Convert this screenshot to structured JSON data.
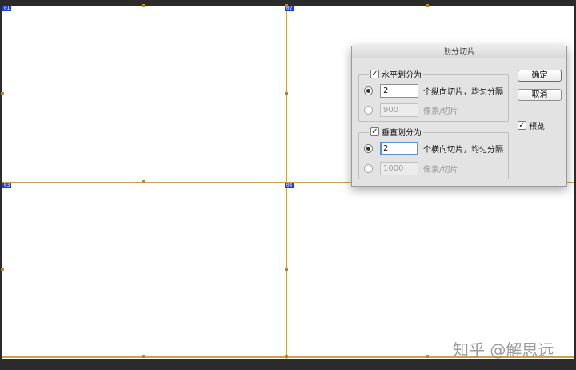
{
  "slices": {
    "tag1": "01",
    "tag2": "02",
    "tag3": "03",
    "tag4": "04"
  },
  "watermark": "知乎 @解思远",
  "dialog": {
    "title": "划分切片",
    "horizontal": {
      "checkbox_label": "水平划分为",
      "checked": true,
      "option1_value": "2",
      "option1_suffix": "个纵向切片，均匀分隔",
      "option2_placeholder": "900",
      "option2_suffix": "像素/切片"
    },
    "vertical": {
      "checkbox_label": "垂直划分为",
      "checked": true,
      "option1_value": "2",
      "option1_suffix": "个横向切片，均匀分隔",
      "option2_placeholder": "1000",
      "option2_suffix": "像素/切片"
    },
    "ok_label": "确定",
    "cancel_label": "取消",
    "preview_label": "预览",
    "check_mark": "✓"
  }
}
